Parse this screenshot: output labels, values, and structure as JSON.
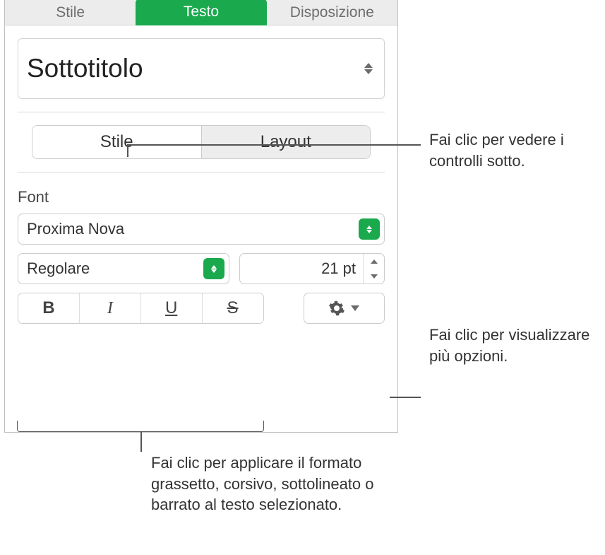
{
  "top_tabs": {
    "stile": "Stile",
    "testo": "Testo",
    "disposizione": "Disposizione"
  },
  "paragraph_style": {
    "value": "Sottotitolo"
  },
  "sub_tabs": {
    "stile": "Stile",
    "layout": "Layout"
  },
  "font": {
    "label": "Font",
    "family": "Proxima Nova",
    "style": "Regolare",
    "size": "21 pt",
    "bold": "B",
    "italic": "I",
    "underline": "U",
    "strike": "S"
  },
  "callouts": {
    "subtabs": "Fai clic per vedere i controlli sotto.",
    "more": "Fai clic per visualizzare più opzioni.",
    "bius": "Fai clic per applicare il formato grassetto, corsivo, sottolineato o barrato al testo selezionato."
  }
}
